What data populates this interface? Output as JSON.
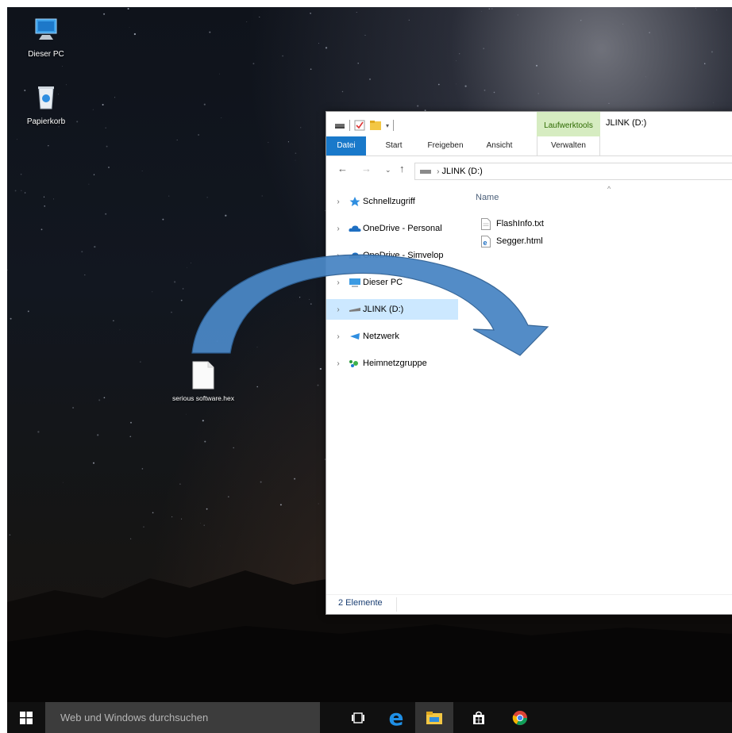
{
  "desktop": {
    "icons": [
      {
        "label": "Dieser PC"
      },
      {
        "label": "Papierkorb"
      }
    ],
    "file": {
      "label": "serious software.hex"
    }
  },
  "window": {
    "title": "JLINK (D:)",
    "context_tab": "Laufwerktools",
    "tabs": [
      "Datei",
      "Start",
      "Freigeben",
      "Ansicht",
      "Verwalten"
    ],
    "address": "JLINK (D:)",
    "nav_items": [
      {
        "label": "Schnellzugriff"
      },
      {
        "label": "OneDrive - Personal"
      },
      {
        "label": "OneDrive - Simvelop"
      },
      {
        "label": "Dieser PC"
      },
      {
        "label": "JLINK (D:)",
        "selected": true
      },
      {
        "label": "Netzwerk"
      },
      {
        "label": "Heimnetzgruppe"
      }
    ],
    "column_header": "Name",
    "files": [
      {
        "name": "FlashInfo.txt",
        "icon": "text-file-icon"
      },
      {
        "name": "Segger.html",
        "icon": "html-file-icon"
      }
    ],
    "status": "2 Elemente"
  },
  "taskbar": {
    "search_placeholder": "Web und Windows durchsuchen",
    "apps": [
      "task-view-icon",
      "edge-icon",
      "file-explorer-icon",
      "store-icon",
      "chrome-icon"
    ]
  },
  "colors": {
    "accent": "#1979ca",
    "selection": "#cce8ff",
    "context_tab": "#d6ecc1",
    "arrow_fill": "#4a86c4"
  }
}
